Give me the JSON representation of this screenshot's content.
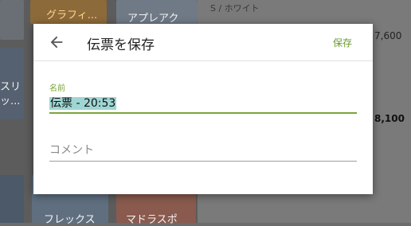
{
  "background": {
    "product_labels": [
      "グラフィ...",
      "アプレアク",
      "フレックス",
      "マドラスポ"
    ],
    "partial_labels": [
      "スリ",
      "ッ..."
    ],
    "variant": "S / ホワイト",
    "prices": [
      "7,600",
      "8,100"
    ]
  },
  "dialog": {
    "title": "伝票を保存",
    "save_label": "保存",
    "name_label": "名前",
    "name_value": "伝票 - 20:53",
    "comment_placeholder": "コメント"
  },
  "colors": {
    "accent": "#7aa33a",
    "selection": "#9fd6d3"
  },
  "icons": {
    "back": "arrow-left-icon"
  }
}
